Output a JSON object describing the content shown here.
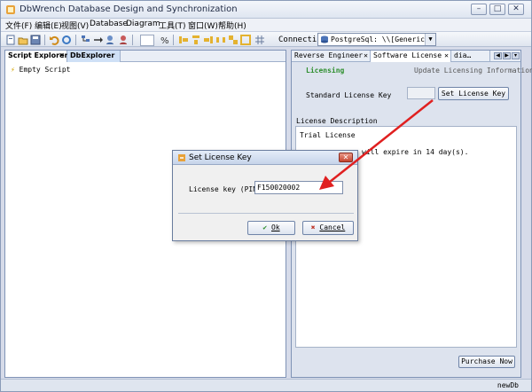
{
  "window": {
    "title": "DbWrench Database Design and Synchronization",
    "min_label": "–",
    "max_label": "□",
    "close_label": "✕"
  },
  "menu": [
    "文件(F)",
    "编辑(E)",
    "视图(V)",
    "Database",
    "Diagram",
    "工具(T)",
    "窗口(W)",
    "帮助(H)"
  ],
  "toolbar": {
    "connection_label": "Connection:",
    "connection_value": "PostgreSql: \\\\[Generic]\\",
    "connection_arrow": "▼"
  },
  "left_tabs": [
    "Script Explorer",
    "DbExplorer"
  ],
  "left_tab_close": "✕",
  "script_explorer": {
    "item": "Empty Script"
  },
  "right_tabs": [
    "Reverse Engineer",
    "Software License",
    "dia…"
  ],
  "right_tab_close": "✕",
  "license": {
    "tab_licensing": "Licensing",
    "tab_update": "Update Licensing Information",
    "standard_key_label": "Standard License Key",
    "set_key_button": "Set License Key",
    "description_label": "License Description",
    "description_line1": "Trial License",
    "description_line2": "will expire in 14 day(s).",
    "purchase_button": "Purchase Now"
  },
  "status": {
    "text": "newDb"
  },
  "dialog": {
    "title": "Set License Key",
    "close_label": "✕",
    "field_label": "License key (PIN)",
    "field_value": "F150020002",
    "ok_label": "Ok",
    "cancel_label": "Cancel"
  },
  "colors": {
    "annotation_arrow": "#e02020",
    "licensing_green": "#2f8f2f"
  }
}
